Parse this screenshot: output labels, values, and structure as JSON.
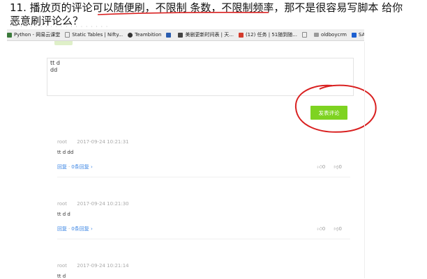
{
  "question": {
    "line1": "11. 播放页的评论可以随便刷，不限制 条数，不限制频率，那不是很容易写脚本 给你",
    "line2": "恶意刷评论么？"
  },
  "bookmarks": [
    {
      "label": "Python - 网易云课堂",
      "icon": "python-icon",
      "color": "#3b7a3b"
    },
    {
      "label": "Static Tables | Nifty...",
      "icon": "page-icon",
      "color": "#8a8a8a"
    },
    {
      "label": "Teambition",
      "icon": "teambition-icon",
      "color": "#333333"
    },
    {
      "label": "",
      "icon": "bookmark-icon",
      "color": "#2a5db0"
    },
    {
      "label": "美剧更新时间表 | 天...",
      "icon": "tv-icon",
      "color": "#444444"
    },
    {
      "label": "(12) 任务 | 51随到随...",
      "icon": "task-icon",
      "color": "#d33b2c"
    },
    {
      "label": "",
      "icon": "page-icon",
      "color": "#8a8a8a"
    },
    {
      "label": "oldboycrm",
      "icon": "folder-icon",
      "color": "#9a9a9a"
    },
    {
      "label": "SANKEO - Bra",
      "icon": "be-icon",
      "color": "#1c5fd0"
    }
  ],
  "textarea": {
    "value_lines": [
      "tt d",
      "dd"
    ]
  },
  "post_button": {
    "label": "发表评论"
  },
  "comments": [
    {
      "user": "root",
      "time": "2017-09-24 10:21:31",
      "text": "tt d dd",
      "reply": "回复",
      "replies": "0条回复",
      "likes": "0",
      "dislikes": "0"
    },
    {
      "user": "root",
      "time": "2017-09-24 10:21:30",
      "text": "tt d d",
      "reply": "回复",
      "replies": "0条回复",
      "likes": "0",
      "dislikes": "0"
    },
    {
      "user": "root",
      "time": "2017-09-24 10:21:14",
      "text": "tt d",
      "reply": "回复",
      "replies": "0条回复",
      "likes": "0",
      "dislikes": "0"
    }
  ],
  "colors": {
    "accent": "#7ed321",
    "link": "#3a84e4",
    "annotation": "#d92020"
  }
}
